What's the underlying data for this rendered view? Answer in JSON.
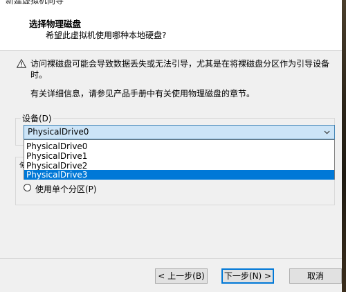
{
  "window": {
    "title": "新建虚拟机向导"
  },
  "header": {
    "title": "选择物理磁盘",
    "subtitle": "希望此虚拟机使用哪种本地硬盘?"
  },
  "warning": {
    "icon": "warning-triangle-icon",
    "text": "访问裸磁盘可能会导致数据丢失或无法引导，尤其是在将裸磁盘分区作为引导设备时。"
  },
  "info": {
    "text": "有关详细信息，请参见产品手册中有关使用物理磁盘的章节。"
  },
  "device": {
    "label": "设备(D)",
    "selected": "PhysicalDrive0",
    "options": [
      "PhysicalDrive0",
      "PhysicalDrive1",
      "PhysicalDrive2",
      "PhysicalDrive3"
    ],
    "highlighted_index": 3
  },
  "usage": {
    "partial_label": "使",
    "single_partition_label": "使用单个分区(P)"
  },
  "buttons": {
    "back": "< 上一步(B)",
    "next": "下一步(N) >",
    "cancel": "取消"
  },
  "colors": {
    "accent": "#0078d7",
    "selection": "#cce4f7"
  }
}
